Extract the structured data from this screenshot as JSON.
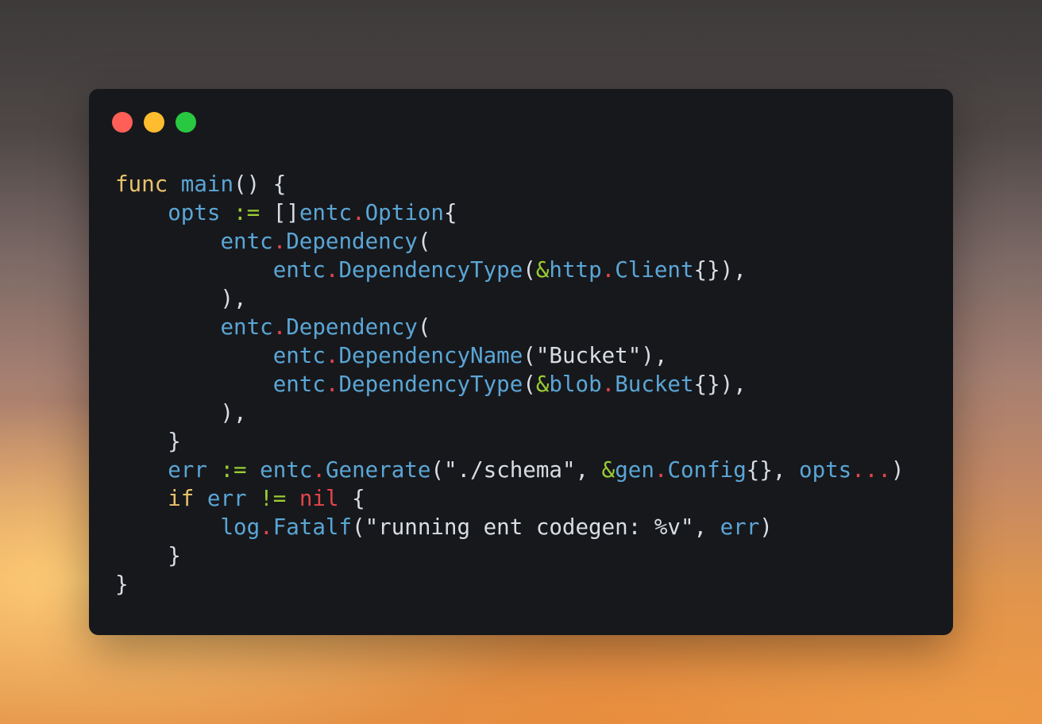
{
  "window": {
    "buttons": {
      "close_color": "#ff5f57",
      "minimize_color": "#febc2e",
      "zoom_color": "#28c840"
    }
  },
  "code": {
    "language": "go",
    "lines": [
      [
        {
          "t": "func",
          "c": "kw"
        },
        {
          "t": " ",
          "c": "punct"
        },
        {
          "t": "main",
          "c": "fn"
        },
        {
          "t": "() {",
          "c": "punct"
        }
      ],
      [
        {
          "t": "    ",
          "c": "punct"
        },
        {
          "t": "opts",
          "c": "id"
        },
        {
          "t": " ",
          "c": "punct"
        },
        {
          "t": ":=",
          "c": "op"
        },
        {
          "t": " []",
          "c": "punct"
        },
        {
          "t": "entc",
          "c": "id"
        },
        {
          "t": ".",
          "c": "dot-op"
        },
        {
          "t": "Option",
          "c": "id"
        },
        {
          "t": "{",
          "c": "punct"
        }
      ],
      [
        {
          "t": "        ",
          "c": "punct"
        },
        {
          "t": "entc",
          "c": "id"
        },
        {
          "t": ".",
          "c": "dot-op"
        },
        {
          "t": "Dependency",
          "c": "id"
        },
        {
          "t": "(",
          "c": "punct"
        }
      ],
      [
        {
          "t": "            ",
          "c": "punct"
        },
        {
          "t": "entc",
          "c": "id"
        },
        {
          "t": ".",
          "c": "dot-op"
        },
        {
          "t": "DependencyType",
          "c": "id"
        },
        {
          "t": "(",
          "c": "punct"
        },
        {
          "t": "&",
          "c": "op"
        },
        {
          "t": "http",
          "c": "id"
        },
        {
          "t": ".",
          "c": "dot-op"
        },
        {
          "t": "Client",
          "c": "id"
        },
        {
          "t": "{}),",
          "c": "punct"
        }
      ],
      [
        {
          "t": "        ),",
          "c": "punct"
        }
      ],
      [
        {
          "t": "        ",
          "c": "punct"
        },
        {
          "t": "entc",
          "c": "id"
        },
        {
          "t": ".",
          "c": "dot-op"
        },
        {
          "t": "Dependency",
          "c": "id"
        },
        {
          "t": "(",
          "c": "punct"
        }
      ],
      [
        {
          "t": "            ",
          "c": "punct"
        },
        {
          "t": "entc",
          "c": "id"
        },
        {
          "t": ".",
          "c": "dot-op"
        },
        {
          "t": "DependencyName",
          "c": "id"
        },
        {
          "t": "(\"Bucket\"),",
          "c": "punct"
        }
      ],
      [
        {
          "t": "            ",
          "c": "punct"
        },
        {
          "t": "entc",
          "c": "id"
        },
        {
          "t": ".",
          "c": "dot-op"
        },
        {
          "t": "DependencyType",
          "c": "id"
        },
        {
          "t": "(",
          "c": "punct"
        },
        {
          "t": "&",
          "c": "op"
        },
        {
          "t": "blob",
          "c": "id"
        },
        {
          "t": ".",
          "c": "dot-op"
        },
        {
          "t": "Bucket",
          "c": "id"
        },
        {
          "t": "{}),",
          "c": "punct"
        }
      ],
      [
        {
          "t": "        ),",
          "c": "punct"
        }
      ],
      [
        {
          "t": "    }",
          "c": "punct"
        }
      ],
      [
        {
          "t": "    ",
          "c": "punct"
        },
        {
          "t": "err",
          "c": "id"
        },
        {
          "t": " ",
          "c": "punct"
        },
        {
          "t": ":=",
          "c": "op"
        },
        {
          "t": " ",
          "c": "punct"
        },
        {
          "t": "entc",
          "c": "id"
        },
        {
          "t": ".",
          "c": "dot-op"
        },
        {
          "t": "Generate",
          "c": "id"
        },
        {
          "t": "(\"./schema\", ",
          "c": "punct"
        },
        {
          "t": "&",
          "c": "op"
        },
        {
          "t": "gen",
          "c": "id"
        },
        {
          "t": ".",
          "c": "dot-op"
        },
        {
          "t": "Config",
          "c": "id"
        },
        {
          "t": "{}, ",
          "c": "punct"
        },
        {
          "t": "opts",
          "c": "id"
        },
        {
          "t": "...",
          "c": "dot-op"
        },
        {
          "t": ")",
          "c": "punct"
        }
      ],
      [
        {
          "t": "    ",
          "c": "punct"
        },
        {
          "t": "if",
          "c": "kw"
        },
        {
          "t": " ",
          "c": "punct"
        },
        {
          "t": "err",
          "c": "id"
        },
        {
          "t": " ",
          "c": "punct"
        },
        {
          "t": "!=",
          "c": "op"
        },
        {
          "t": " ",
          "c": "punct"
        },
        {
          "t": "nil",
          "c": "nil"
        },
        {
          "t": " {",
          "c": "punct"
        }
      ],
      [
        {
          "t": "        ",
          "c": "punct"
        },
        {
          "t": "log",
          "c": "id"
        },
        {
          "t": ".",
          "c": "dot-op"
        },
        {
          "t": "Fatalf",
          "c": "id"
        },
        {
          "t": "(\"running ent codegen: %v\", ",
          "c": "punct"
        },
        {
          "t": "err",
          "c": "id"
        },
        {
          "t": ")",
          "c": "punct"
        }
      ],
      [
        {
          "t": "    }",
          "c": "punct"
        }
      ],
      [
        {
          "t": "}",
          "c": "punct"
        }
      ]
    ]
  }
}
